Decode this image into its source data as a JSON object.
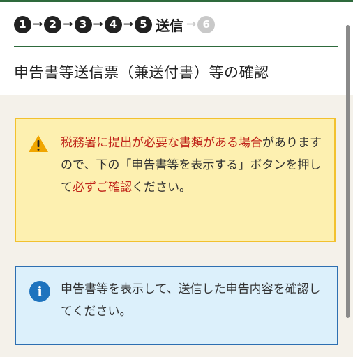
{
  "steps": {
    "items": [
      "1",
      "2",
      "3",
      "4",
      "5",
      "6"
    ],
    "current_label": "送信",
    "arrow": "→"
  },
  "page_title": "申告書等送信票（兼送付書）等の確認",
  "warning": {
    "icon": "warning-triangle-icon",
    "segments": [
      "税務署に提出が必要な書類がある場合",
      "がありますので、下の「申告書等を表示する」ボタンを押して",
      "必ずご確認",
      "ください。"
    ]
  },
  "info": {
    "icon": "info-icon",
    "icon_glyph": "i",
    "text": "申告書等を表示して、送信した申告内容を確認してください。"
  },
  "colors": {
    "accent_green": "#2e6a3c",
    "warning_bg": "#fdf0b0",
    "warning_border": "#f2c12e",
    "warning_red": "#c0241a",
    "info_bg": "#dcf0fb",
    "info_border": "#2d6fb1"
  }
}
